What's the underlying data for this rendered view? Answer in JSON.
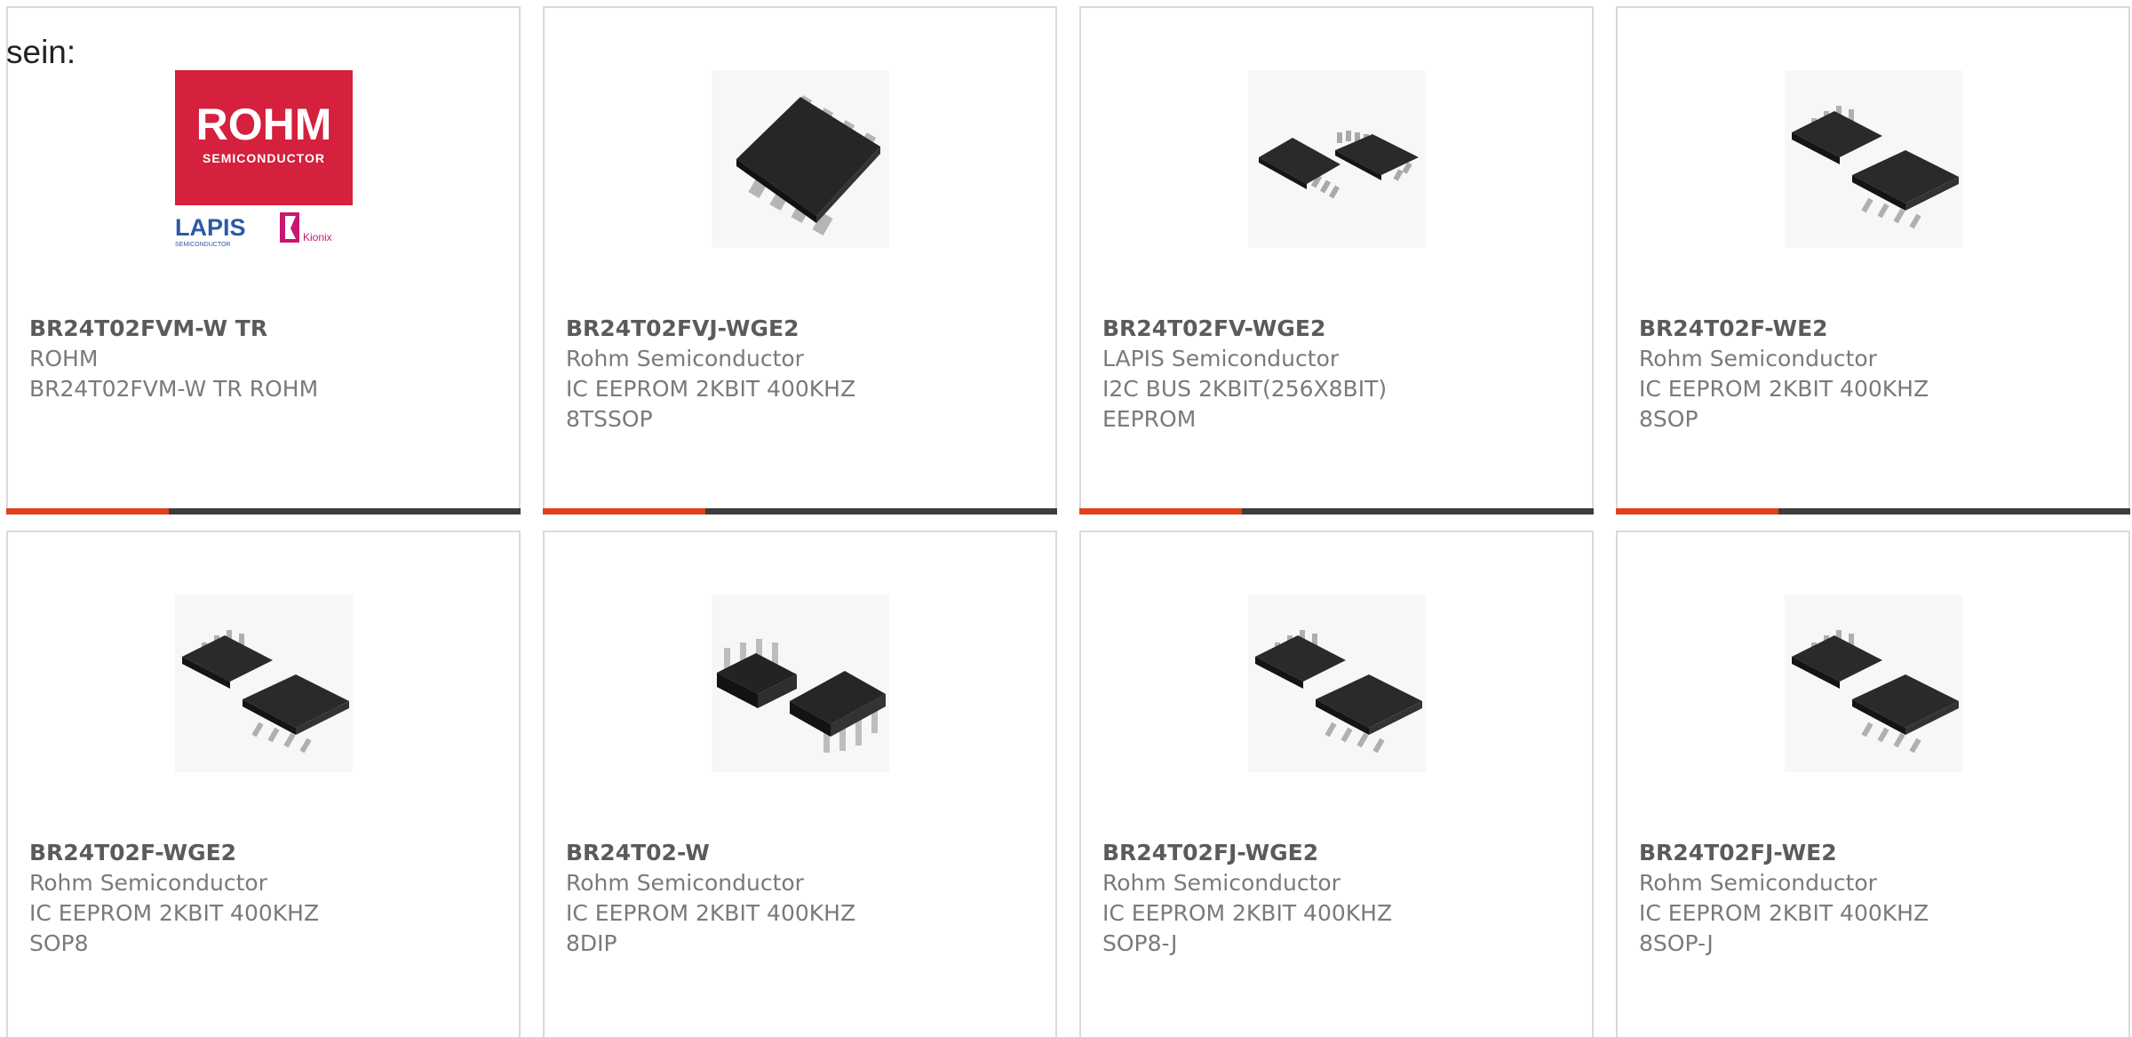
{
  "intro_text": "sein:",
  "accent_color": "#e2401c",
  "bar_color": "#3d3d3d",
  "products": [
    {
      "part": "BR24T02FVM-W TR",
      "maker": "ROHM",
      "desc": "BR24T02FVM-W TR ROHM",
      "image": "rohm-lapis-kionix-logo"
    },
    {
      "part": "BR24T02FVJ-WGE2",
      "maker": "Rohm Semiconductor",
      "desc": "IC EEPROM 2KBIT 400KHZ 8TSSOP",
      "image": "ic-tssop-chip"
    },
    {
      "part": "BR24T02FV-WGE2",
      "maker": "LAPIS Semiconductor",
      "desc": "I2C BUS 2KBIT(256X8BIT) EEPROM",
      "image": "ic-ssop-chips"
    },
    {
      "part": "BR24T02F-WE2",
      "maker": "Rohm Semiconductor",
      "desc": "IC EEPROM 2KBIT 400KHZ 8SOP",
      "image": "ic-sop-chips"
    },
    {
      "part": "BR24T02F-WGE2",
      "maker": "Rohm Semiconductor",
      "desc": "IC EEPROM 2KBIT 400KHZ SOP8",
      "image": "ic-sop-chips"
    },
    {
      "part": "BR24T02-W",
      "maker": "Rohm Semiconductor",
      "desc": "IC EEPROM 2KBIT 400KHZ 8DIP",
      "image": "ic-dip-chips"
    },
    {
      "part": "BR24T02FJ-WGE2",
      "maker": "Rohm Semiconductor",
      "desc": "IC EEPROM 2KBIT 400KHZ SOP8-J",
      "image": "ic-sop-chips"
    },
    {
      "part": "BR24T02FJ-WE2",
      "maker": "Rohm Semiconductor",
      "desc": "IC EEPROM 2KBIT 400KHZ 8SOP-J",
      "image": "ic-sop-chips"
    }
  ],
  "logo": {
    "brand_main": "ROHM",
    "brand_sub": "SEMICONDUCTOR",
    "lapis": "LAPIS",
    "lapis_sub": "SEMICONDUCTOR",
    "kionix": "Kionix"
  }
}
